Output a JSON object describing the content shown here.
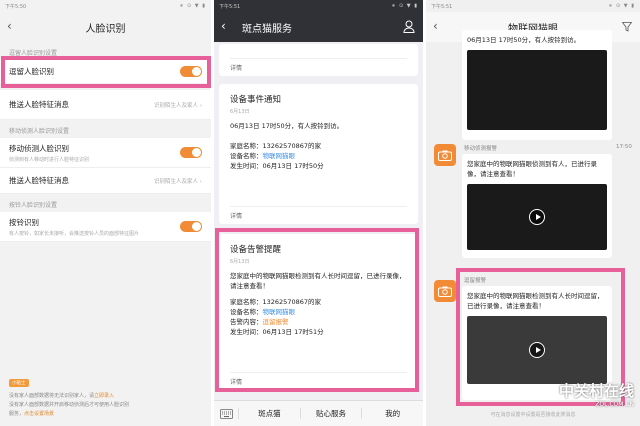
{
  "p1": {
    "status": {
      "time": "下午5:50",
      "icons": "∗ ⊙ ▼ ▮"
    },
    "title": "人脸识别",
    "section1": "逗留人脸识别设置",
    "row_stay": "逗留人脸识别",
    "row_push1": {
      "label": "推送人脸特征消息",
      "value": "识别陌生人及家人"
    },
    "section2": "移动侦测人脸识别设置",
    "row_motion": {
      "label": "移动侦测人脸识别",
      "sub": "侦测到有人移动时进行人脸特征识别"
    },
    "row_push2": {
      "label": "推送人脸特征消息",
      "value": "识别陌生人及家人"
    },
    "section3": "按铃人脸识别设置",
    "row_ring": {
      "label": "按铃识别",
      "sub": "有人按铃，如家长未接听，会推送按铃人员的面部特征图片"
    },
    "tip_badge": "小贴士",
    "tip1": "没有家人面部数据将无法识别家人，请",
    "tip1_link": "立即录入",
    "tip2": "没有家人面部数据并开启移动侦测后才可使用人脸识别",
    "tip3": "服务，",
    "tip3_link": "点击设置场景"
  },
  "p2": {
    "status": {
      "time": "下午5:51",
      "icons": "∗ ⊙ ▼ ▮"
    },
    "title": "斑点猫服务",
    "top_detail": "详情",
    "card1": {
      "title": "设备事件通知",
      "date": "6月13日",
      "line1": "06月13日 17时50分，有人按铃到访。",
      "home_label": "家庭名称：",
      "home": "13262570867的家",
      "dev_label": "设备名称：",
      "dev": "物联网猫眼",
      "time_label": "发生时间：",
      "time": "06月13日 17时50分",
      "detail": "详情"
    },
    "card2": {
      "title": "设备告警提醒",
      "date": "6月13日",
      "line1": "您家庭中的物联网猫眼检测到有人长时间逗留，已进行录像，请注意查看！",
      "home_label": "家庭名称：",
      "home": "13262570867的家",
      "dev_label": "设备名称：",
      "dev": "物联网猫眼",
      "alarm_label": "告警内容：",
      "alarm": "逗留报警",
      "time_label": "发生时间：",
      "time": "06月13日 17时51分",
      "detail": "详情"
    },
    "tabs": [
      "斑点猫",
      "贴心服务",
      "我的"
    ]
  },
  "p3": {
    "status": {
      "time": "下午5:51",
      "icons": "∗ ⊙ ▼ ▮"
    },
    "title": "物联网猫眼",
    "top_text": "06月13日 17时50分，有人按铃到访。",
    "msg1": {
      "label": "移动侦测报警",
      "time": "17:50",
      "text": "您家庭中的物联网猫眼侦测到有人，已进行录像，请注意查看！"
    },
    "msg2": {
      "label": "逗留报警",
      "text": "您家庭中的物联网猫眼检测到有人长时间逗留，已进行录像，请注意查看！"
    },
    "footer": "可在消息设置中设置是否接收此类消息",
    "footer_link": "消息设置"
  },
  "watermark": {
    "line1": "中关村在线",
    "line2": "ZOL.COM.CN"
  },
  "colors": {
    "highlight": "#e8609a",
    "accent": "#f28b35",
    "link_blue": "#3a8ee6"
  }
}
